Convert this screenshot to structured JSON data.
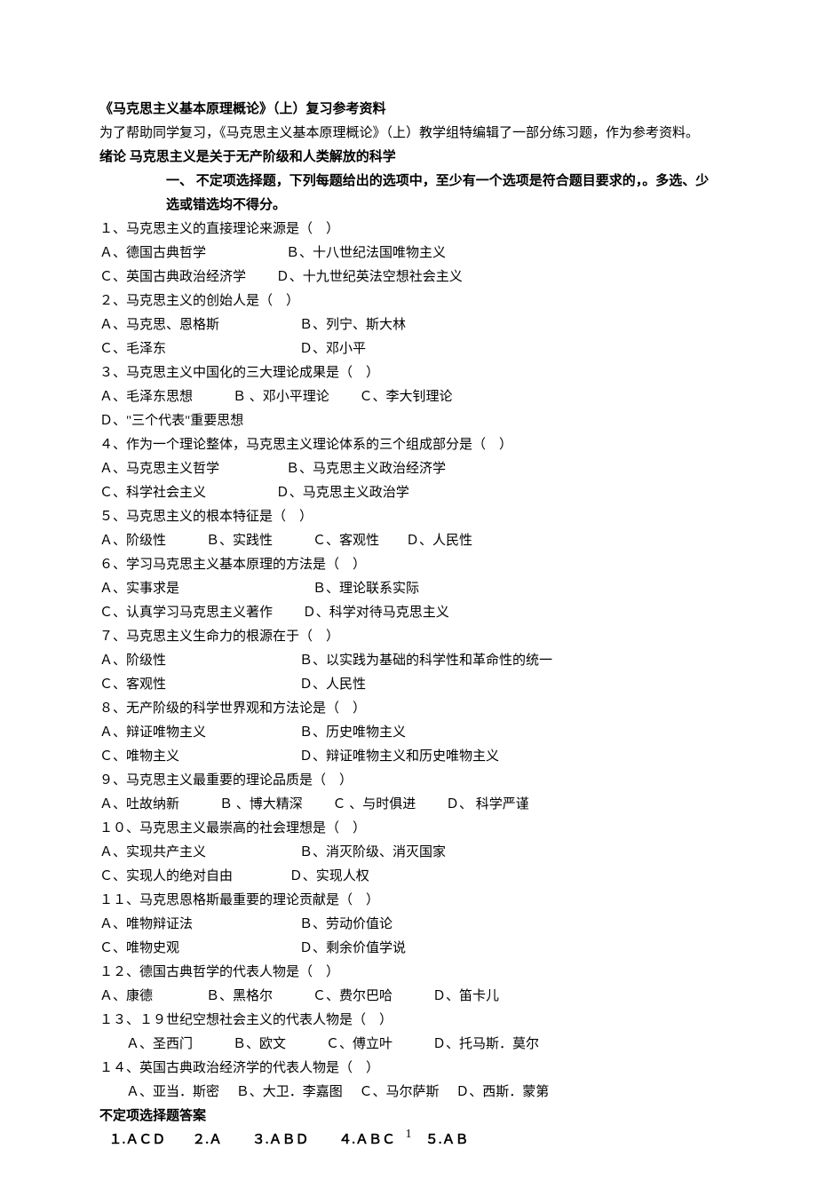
{
  "title": "《马克思主义基本原理概论》（上）复习参考资料",
  "intro_note": "为了帮助同学复习，《马克思主义基本原理概论》（上）教学组特编辑了一部分练习题，作为参考资料。",
  "section_title": "绪论  马克思主义是关于无产阶级和人类解放的科学",
  "instruction_label": "一、",
  "instruction_text": "不定项选择题，下列每题给出的选项中，至少有一个选项是符合题目要求的，。多选、少选或错选均不得分。",
  "questions": [
    {
      "q": "１、马克思主义的直接理论来源是（　）",
      "opts": [
        "Ａ、德国古典哲学　　　　　　Ｂ、十八世纪法国唯物主义",
        "Ｃ、英国古典政治经济学　　  Ｄ、十九世纪英法空想社会主义"
      ]
    },
    {
      "q": "２、马克思主义的创始人是（　）",
      "opts": [
        "Ａ、马克思、恩格斯　　　　　　Ｂ、列宁、斯大林",
        "Ｃ、毛泽东　　　　　　　　　　Ｄ、邓小平"
      ]
    },
    {
      "q": "３、马克思主义中国化的三大理论成果是（　）",
      "opts": [
        "Ａ、毛泽东思想　　　Ｂ 、邓小平理论　　  Ｃ、李大钊理论",
        "Ｄ、\"三个代表\"重要思想"
      ]
    },
    {
      "q": "４、作为一个理论整体，马克思主义理论体系的三个组成部分是（　）",
      "opts": [
        "Ａ、马克思主义哲学　　　　　Ｂ、马克思主义政治经济学",
        "Ｃ、科学社会主义　　　　　  Ｄ、马克思主义政治学"
      ]
    },
    {
      "q": "５、马克思主义的根本特征是（　）",
      "opts": [
        "Ａ、阶级性　　　Ｂ、实践性　　　Ｃ、客观性　　Ｄ、人民性"
      ]
    },
    {
      "q": "６、学习马克思主义基本原理的方法是（　）",
      "opts": [
        "Ａ、实事求是　　　　　　　　　　Ｂ、理论联系实际",
        "Ｃ、认真学习马克思主义著作　　  Ｄ、科学对待马克思主义"
      ]
    },
    {
      "q": "７、马克思主义生命力的根源在于（　）",
      "opts": [
        "Ａ、阶级性　　　　　　　　　　Ｂ、以实践为基础的科学性和革命性的统一",
        "Ｃ、客观性　　　　　　　　　　Ｄ、人民性"
      ]
    },
    {
      "q": "８、无产阶级的科学世界观和方法论是（　）",
      "opts": [
        "Ａ、辩证唯物主义　　　　　　　Ｂ、历史唯物主义",
        "Ｃ、唯物主义　　　　　　　　　Ｄ、辩证唯物主义和历史唯物主义"
      ]
    },
    {
      "q": "９、马克思主义最重要的理论品质是（　）",
      "opts": [
        "Ａ、吐故纳新　　　Ｂ 、博大精深　　 Ｃ 、与时俱进　　 Ｄ、 科学严谨"
      ]
    },
    {
      "q": "１０、马克思主义最崇高的社会理想是（　）",
      "opts": [
        "Ａ、实现共产主义　　　　　　　Ｂ、消灭阶级、消灭国家",
        "Ｃ、实现人的绝对自由　　　　  Ｄ、实现人权"
      ]
    },
    {
      "q": "１１、马克思恩格斯最重要的理论贡献是（　）",
      "opts": [
        "Ａ、唯物辩证法　　　　　　　　Ｂ、劳动价值论",
        "Ｃ、唯物史观　　　　　　　　　Ｄ、剩余价值学说"
      ]
    },
    {
      "q": "１２、德国古典哲学的代表人物是（　）",
      "opts": [
        "Ａ、康德　　　　Ｂ、黑格尔　　　Ｃ、费尔巴哈　　　Ｄ、笛卡儿"
      ]
    },
    {
      "q": "１３、１９世纪空想社会主义的代表人物是（　）",
      "opts": [
        "　　Ａ、圣西门　　　Ｂ、欧文　　　Ｃ、傅立叶　　　Ｄ、托马斯．莫尔"
      ]
    },
    {
      "q": "１４、英国古典政治经济学的代表人物是（　）",
      "opts": [
        "　　Ａ、亚当．斯密　  Ｂ、大卫．李嘉图　  Ｃ、马尔萨斯　  Ｄ、西斯．蒙第"
      ]
    }
  ],
  "answer_heading": "不定项选择题答案",
  "answer_line": "１.ＡＣＤ　　２.Ａ　　  ３.ＡＢＤ　　  ４.ＡＢＣ　　  ５.ＡＢ",
  "page_number": "1"
}
